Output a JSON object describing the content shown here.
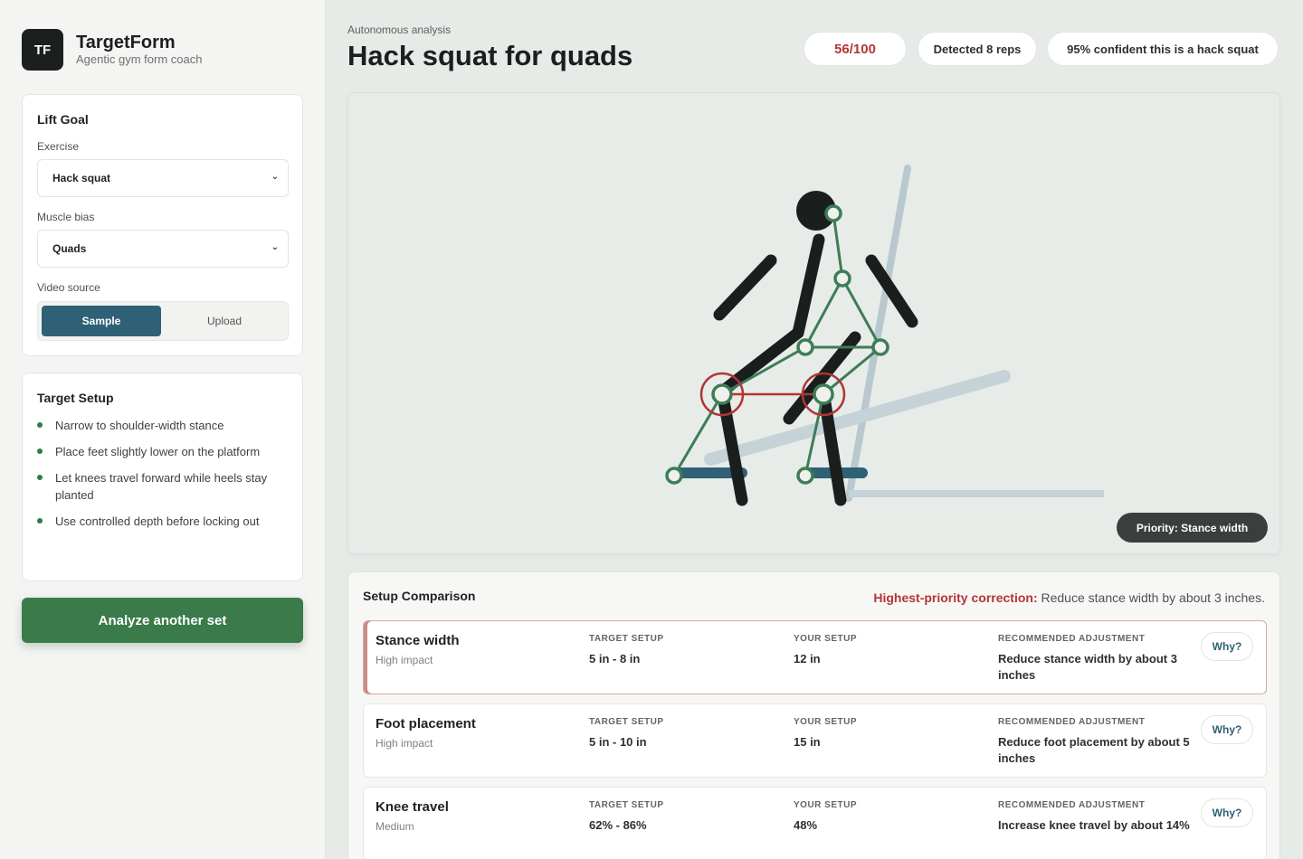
{
  "brand": {
    "initials": "TF",
    "name": "TargetForm",
    "tagline": "Agentic gym form coach"
  },
  "lift_goal": {
    "title": "Lift Goal",
    "exercise_label": "Exercise",
    "exercise_value": "Hack squat",
    "bias_label": "Muscle bias",
    "bias_value": "Quads",
    "source_label": "Video source",
    "source_options": [
      "Sample",
      "Upload"
    ],
    "source_selected": "Sample"
  },
  "target_setup": {
    "title": "Target Setup",
    "items": [
      "Narrow to shoulder-width stance",
      "Place feet slightly lower on the platform",
      "Let knees travel forward while heels stay planted",
      "Use controlled depth before locking out"
    ]
  },
  "actions": {
    "analyze_label": "Analyze another set"
  },
  "header": {
    "eyebrow": "Autonomous analysis",
    "title": "Hack squat for quads",
    "score": "56/100",
    "reps": "Detected 8 reps",
    "confidence": "95% confident this is a hack squat"
  },
  "viewer": {
    "priority": "Priority: Stance width"
  },
  "comparison": {
    "title": "Setup Comparison",
    "note_label": "Highest-priority correction:",
    "note_text": " Reduce stance width by about 3 inches.",
    "col_target": "TARGET SETUP",
    "col_yours": "YOUR SETUP",
    "col_adj": "RECOMMENDED ADJUSTMENT",
    "why_label": "Why?",
    "rows": [
      {
        "name": "Stance width",
        "impact": "High impact",
        "target": "5 in - 8 in",
        "yours": "12 in",
        "adjustment": "Reduce stance width by about 3 inches"
      },
      {
        "name": "Foot placement",
        "impact": "High impact",
        "target": "5 in - 10 in",
        "yours": "15 in",
        "adjustment": "Reduce foot placement by about 5 inches"
      },
      {
        "name": "Knee travel",
        "impact": "Medium",
        "target": "62% - 86%",
        "yours": "48%",
        "adjustment": "Increase knee travel by about 14%"
      }
    ]
  },
  "colors": {
    "accent": "#2f6176",
    "primary_green": "#3a7a4b",
    "alert_red": "#b33535",
    "joint_green": "#3d7d55"
  }
}
